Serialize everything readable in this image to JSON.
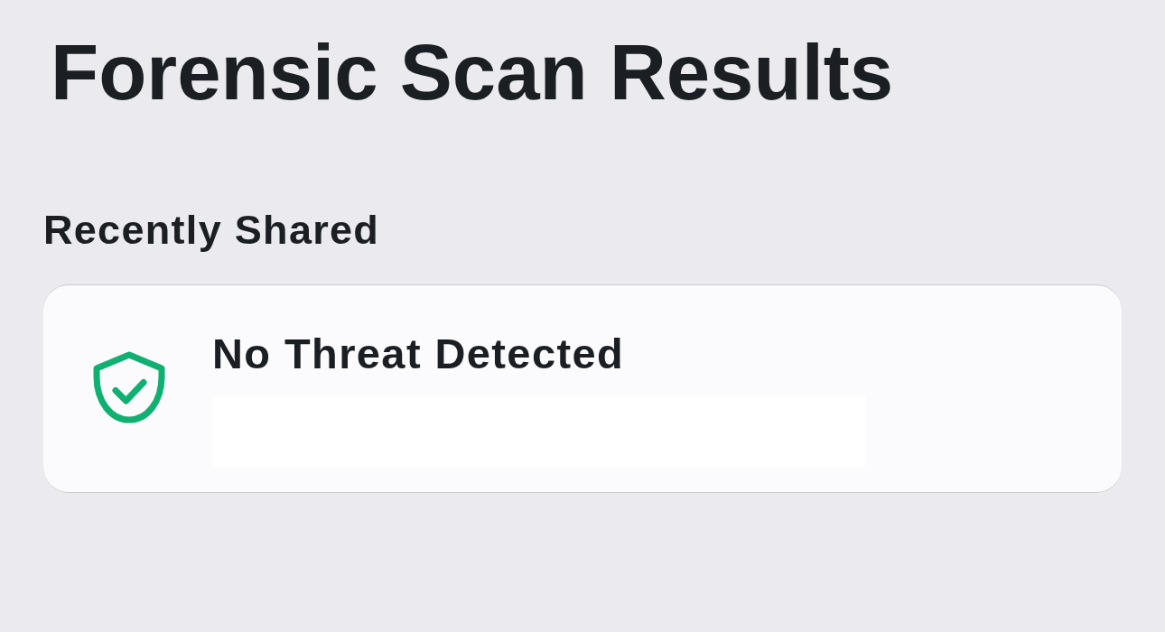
{
  "page": {
    "title": "Forensic Scan Results"
  },
  "sections": [
    {
      "heading": "Recently Shared",
      "results": [
        {
          "kind": "safe",
          "title": "No Threat Detected"
        }
      ]
    }
  ]
}
